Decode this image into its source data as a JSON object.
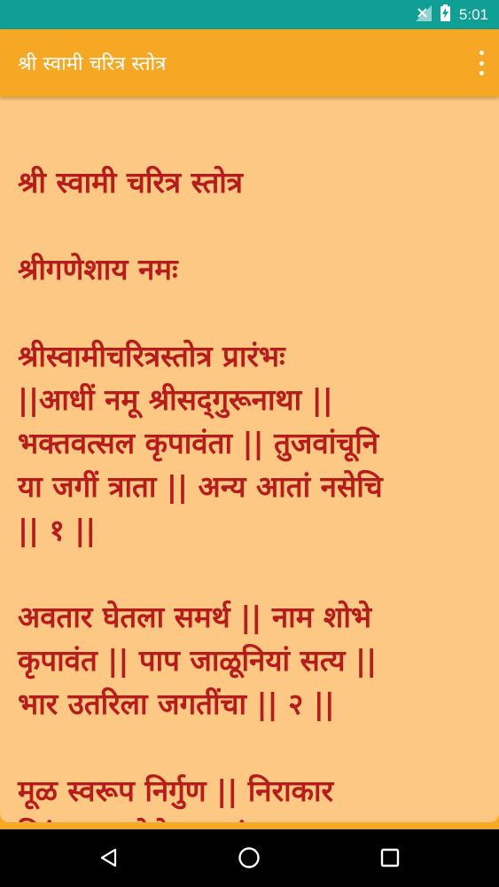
{
  "status_bar": {
    "time": "5:01",
    "icons": [
      "signal-icon",
      "battery-charging-icon"
    ]
  },
  "app_bar": {
    "title": "श्री स्वामी चरित्र स्तोत्र",
    "menu_icon": "overflow-menu-icon"
  },
  "content": {
    "heading": "श्री स्वामी चरित्र स्तोत्र",
    "invocation": "श्रीगणेशाय नमः",
    "verse1": [
      "श्रीस्वामीचरित्रस्तोत्र प्रारंभः",
      "||आधीं नमू श्रीसद्‌गुरूनाथा ||",
      "भक्तवत्सल कृपावंता || तुजवांचूनि",
      "या जगीं त्राता || अन्य आतां नसेचि",
      "|| १ ||"
    ],
    "verse2": [
      "अवतार घेतला समर्थ || नाम शोभे",
      "कृपावंत || पाप जाळूनियां सत्य ||",
      "भार उतरिला जगतींचा || २ ||"
    ],
    "verse3": [
      "मूळ स्वरूप निर्गुण || निराकार",
      "निरंजन || ऐसे असतां"
    ]
  },
  "colors": {
    "status_bar": "#109f95",
    "app_bar": "#f6a723",
    "background": "#fdc883",
    "text": "#b71c1c"
  },
  "nav_bar": {
    "icons": [
      "back-icon",
      "home-icon",
      "recents-icon"
    ]
  }
}
